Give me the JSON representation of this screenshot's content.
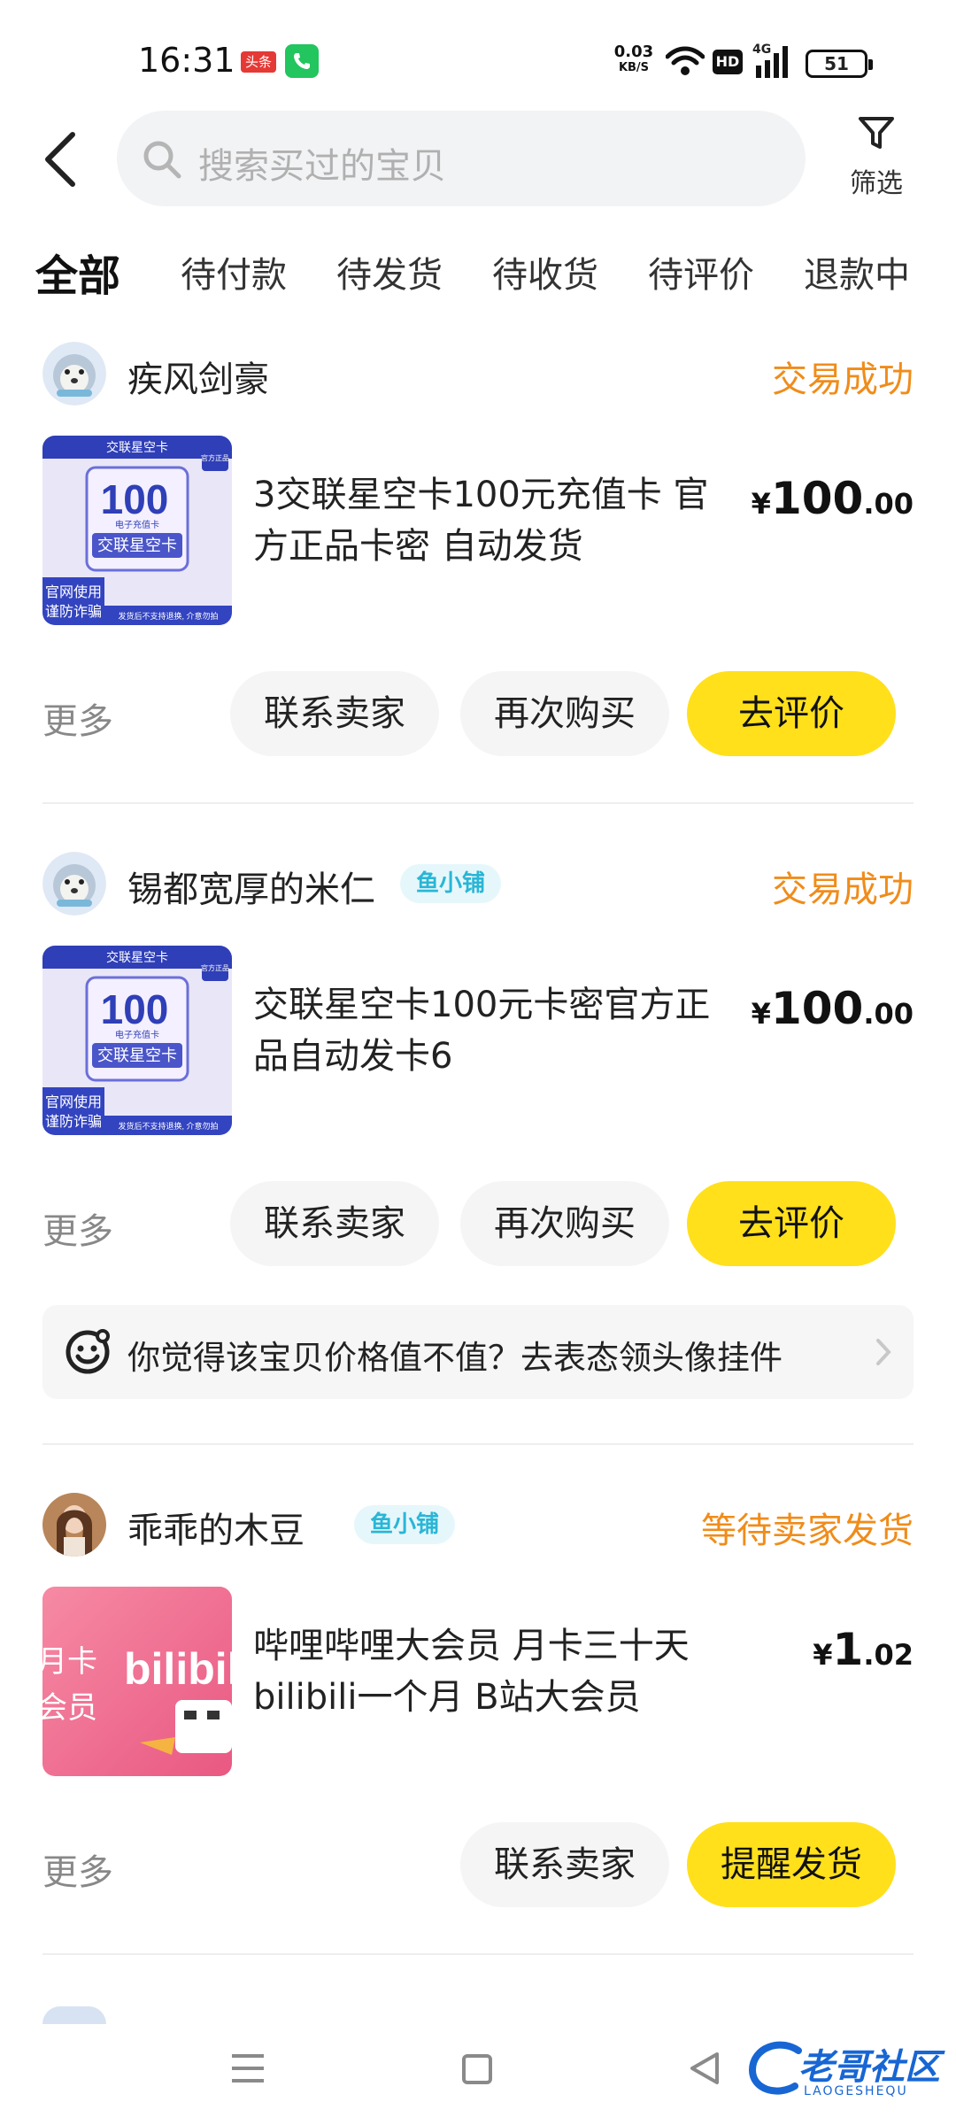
{
  "status_bar": {
    "time": "16:31",
    "news_badge": "头条",
    "net_speed": "0.03",
    "net_unit": "KB/S",
    "hd": "HD",
    "network": "4G",
    "battery": "51"
  },
  "header": {
    "search_placeholder": "搜索买过的宝贝",
    "filter_label": "筛选"
  },
  "tabs": [
    {
      "label": "全部",
      "active": true
    },
    {
      "label": "待付款"
    },
    {
      "label": "待发货"
    },
    {
      "label": "待收货"
    },
    {
      "label": "待评价"
    },
    {
      "label": "退款中"
    }
  ],
  "orders": [
    {
      "shop_name": "疾风剑豪",
      "status": "交易成功",
      "product_title": "3交联星空卡100元充值卡 官方正品卡密 自动发货",
      "price_currency": "¥",
      "price_int": "100",
      "price_dec": ".00",
      "more": "更多",
      "buttons": [
        "联系卖家",
        "再次购买",
        "去评价"
      ],
      "image": {
        "value": "100",
        "sub": "电子充值卡",
        "name": "交联星空卡",
        "top": "交联星空卡",
        "corner": "官方正品",
        "side1": "官网使用",
        "side2": "谨防诈骗",
        "foot": "发货后不支持退换, 介意勿拍"
      }
    },
    {
      "shop_name": "锡都宽厚的米仁",
      "shop_tag": "鱼小铺",
      "status": "交易成功",
      "product_title": "交联星空卡100元卡密官方正品自动发卡6",
      "price_currency": "¥",
      "price_int": "100",
      "price_dec": ".00",
      "more": "更多",
      "buttons": [
        "联系卖家",
        "再次购买",
        "去评价"
      ],
      "image": {
        "value": "100",
        "sub": "电子充值卡",
        "name": "交联星空卡",
        "top": "交联星空卡",
        "corner": "官方正品",
        "side1": "官网使用",
        "side2": "谨防诈骗",
        "foot": "发货后不支持退换, 介意勿拍"
      }
    },
    {
      "shop_name": "乖乖的木豆",
      "shop_tag": "鱼小铺",
      "status": "等待卖家发货",
      "product_title": "哔哩哔哩大会员 月卡三十天 bilibili一个月 B站大会员",
      "price_currency": "¥",
      "price_int": "1",
      "price_dec": ".02",
      "more": "更多",
      "buttons": [
        "联系卖家",
        "提醒发货"
      ],
      "image": {
        "line1": "月卡",
        "line2": "会员",
        "brand": "bilibili"
      }
    }
  ],
  "promo": {
    "text": "你觉得该宝贝价格值不值？去表态领头像挂件"
  },
  "watermark": {
    "text": "老哥社区",
    "sub": "LAOGESHEQU"
  },
  "colors": {
    "accent_yellow": "#ffe01b",
    "status_orange": "#f08c1a",
    "tag_cyan": "#2ab6d6"
  }
}
